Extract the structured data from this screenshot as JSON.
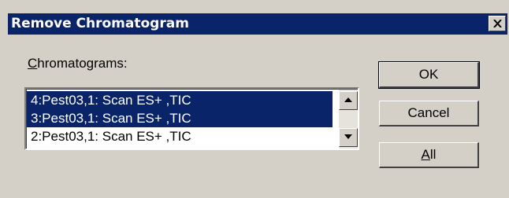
{
  "dialog": {
    "title": "Remove Chromatogram"
  },
  "list": {
    "label_accel": "C",
    "label_rest": "hromatograms:",
    "items": [
      {
        "text": "4:Pest03,1: Scan ES+ ,TIC",
        "selected": true
      },
      {
        "text": "3:Pest03,1: Scan ES+ ,TIC",
        "selected": true
      },
      {
        "text": "2:Pest03,1: Scan ES+ ,TIC",
        "selected": false
      }
    ]
  },
  "buttons": {
    "ok": "OK",
    "cancel": "Cancel",
    "all_accel": "A",
    "all_rest": "ll"
  },
  "colors": {
    "dialog_bg": "#d4d0c8",
    "titlebar": "#0a246a",
    "selection": "#0a246a"
  },
  "icons": [
    "close-icon",
    "scroll-up-arrow-icon",
    "scroll-down-arrow-icon"
  ]
}
